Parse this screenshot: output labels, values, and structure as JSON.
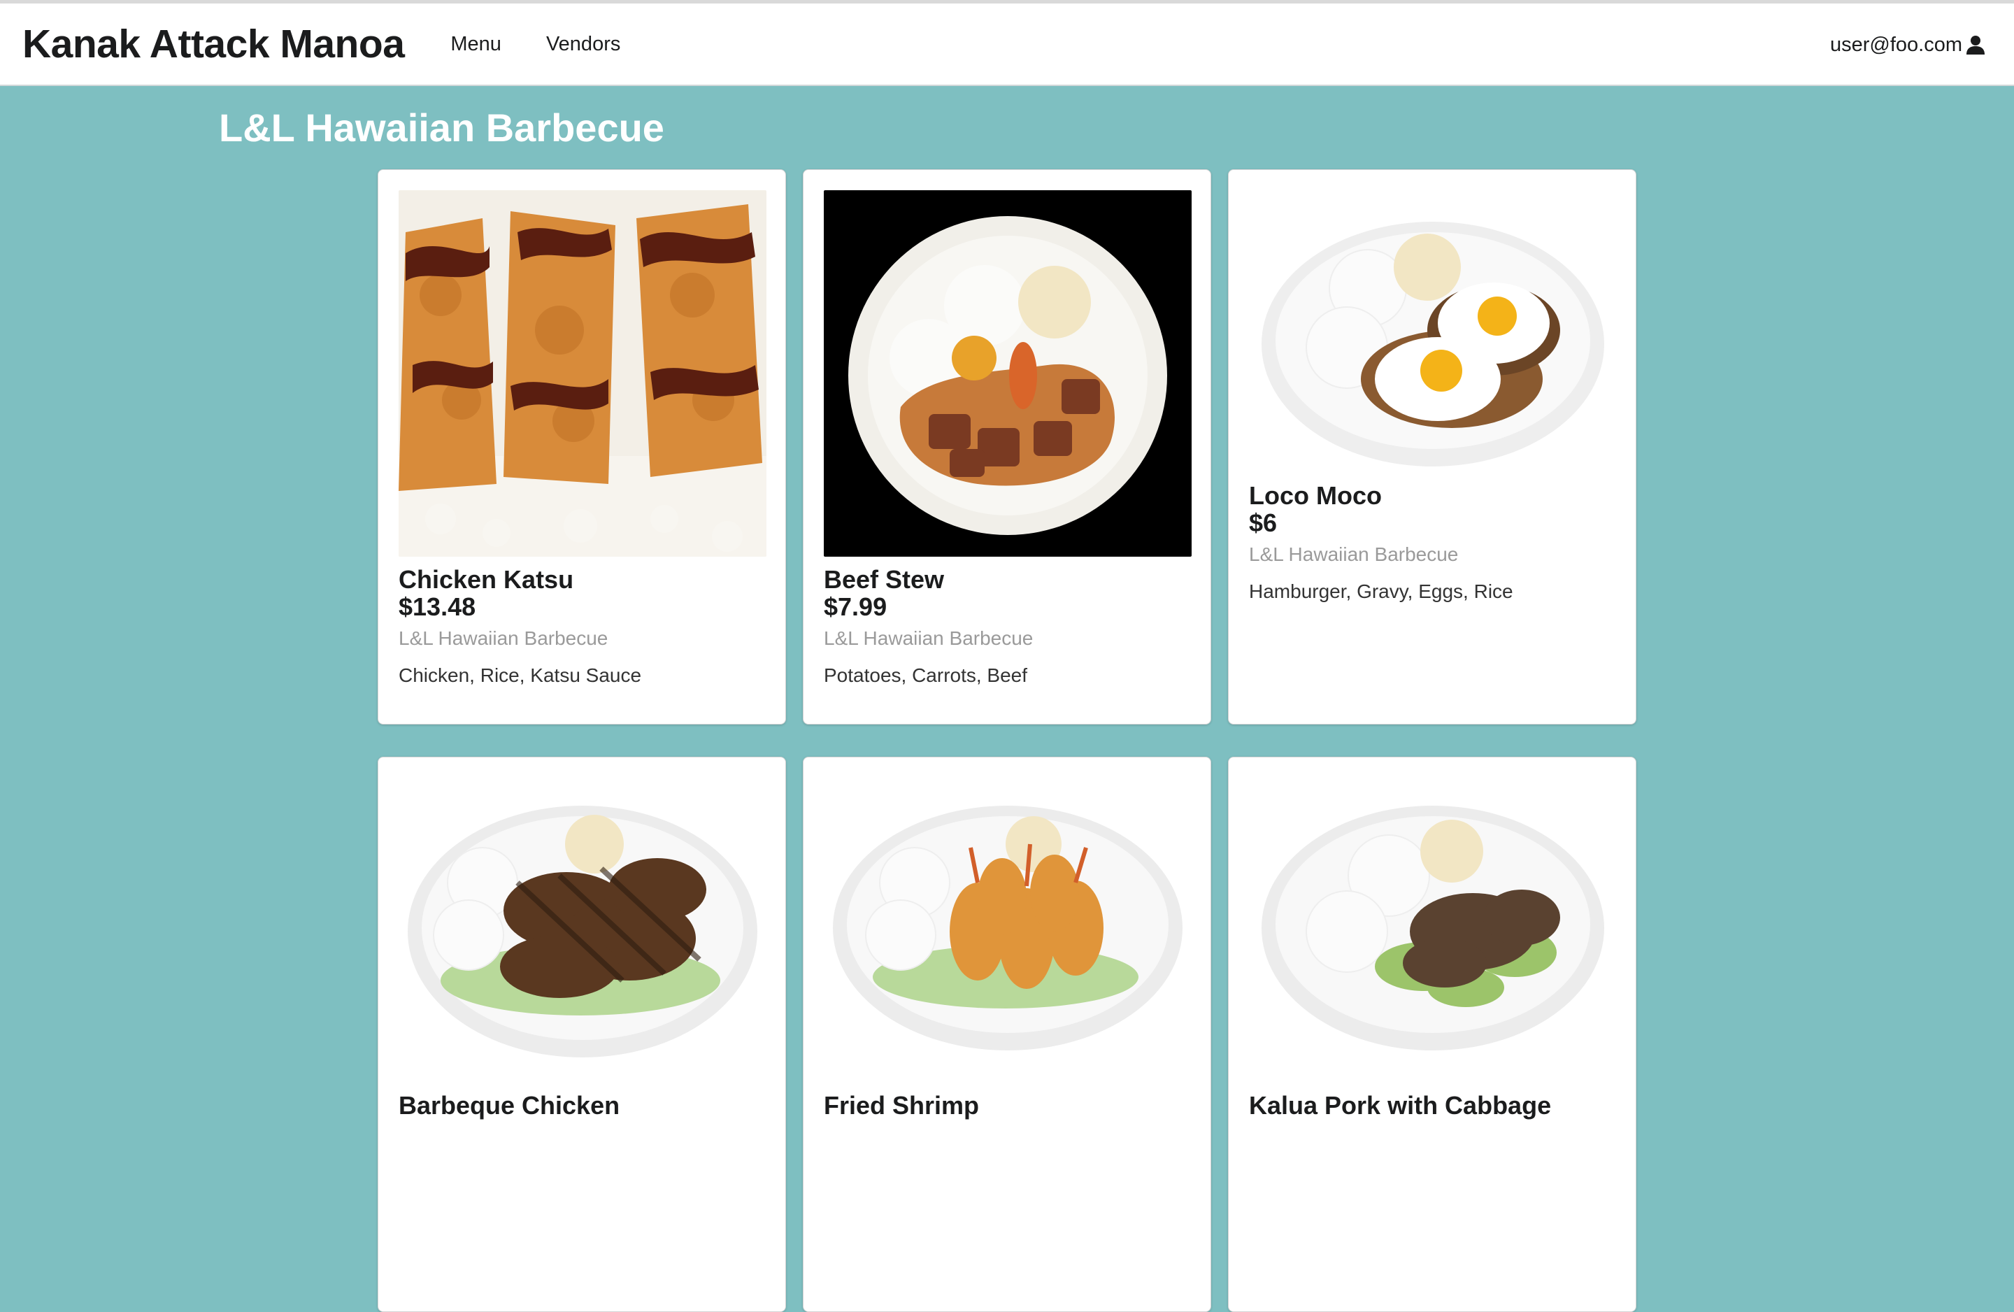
{
  "navbar": {
    "brand": "Kanak Attack Manoa",
    "links": [
      "Menu",
      "Vendors"
    ],
    "user": "user@foo.com"
  },
  "vendor_title": "L&L Hawaiian Barbecue",
  "items": [
    {
      "name": "Chicken Katsu",
      "price": "$13.48",
      "vendor": "L&L Hawaiian Barbecue",
      "description": "Chicken, Rice, Katsu Sauce"
    },
    {
      "name": "Beef Stew",
      "price": "$7.99",
      "vendor": "L&L Hawaiian Barbecue",
      "description": "Potatoes, Carrots, Beef"
    },
    {
      "name": "Loco Moco",
      "price": "$6",
      "vendor": "L&L Hawaiian Barbecue",
      "description": "Hamburger, Gravy, Eggs, Rice"
    },
    {
      "name": "Barbeque Chicken",
      "price": "",
      "vendor": "",
      "description": ""
    },
    {
      "name": "Fried Shrimp",
      "price": "",
      "vendor": "",
      "description": ""
    },
    {
      "name": "Kalua Pork with Cabbage",
      "price": "",
      "vendor": "",
      "description": ""
    }
  ],
  "colors": {
    "page_background": "#7ebfc1",
    "navbar_background": "#ffffff",
    "vendor_title": "#ffffff",
    "muted_text": "#9a9a9a"
  },
  "icons": {
    "user": "user-icon"
  }
}
